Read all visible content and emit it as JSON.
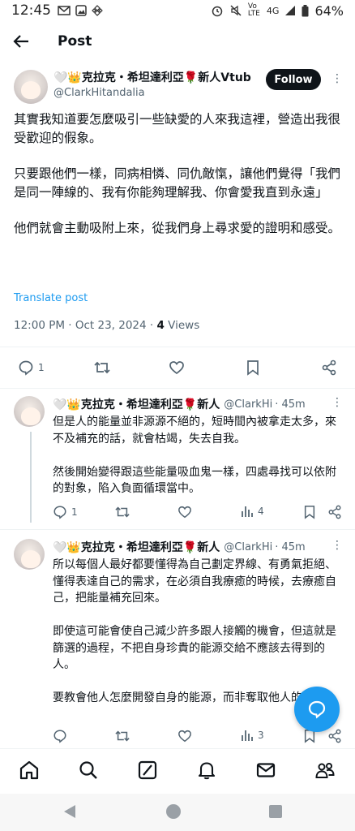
{
  "status_bar": {
    "time": "12:45",
    "network": "4G",
    "battery": "64%",
    "volte": "Vo LTE"
  },
  "header": {
    "title": "Post"
  },
  "main_post": {
    "author_name": "🤍👑克拉克・希坦達利亞🌹新人Vtub",
    "handle": "@ClarkHitandalia",
    "follow_label": "Follow",
    "paragraphs": [
      "其實我知道要怎麼吸引一些缺愛的人來我這裡，營造出我很受歡迎的假象。",
      "只要跟他們一樣，同病相憐、同仇敵愾，讓他們覺得「我們是同一陣線的、我有你能夠理解我、你會愛我直到永遠」",
      "他們就會主動吸附上來，從我們身上尋求愛的證明和感受。"
    ],
    "translate_label": "Translate post",
    "timestamp": "12:00 PM · Oct 23, 2024 · ",
    "views_count": "4",
    "views_label": " Views",
    "reply_count": "1"
  },
  "replies": [
    {
      "author_name": "🤍👑克拉克・希坦達利亞🌹新人",
      "handle": "@ClarkHi",
      "time": "· 45m",
      "paragraphs": [
        "但是人的能量並非源源不絕的，短時間內被拿走太多，來不及補充的話，就會枯竭，失去自我。",
        "然後開始變得跟這些能量吸血鬼一樣，四處尋找可以依附的對象，陷入負面循環當中。"
      ],
      "reply_count": "1",
      "views_count": "4"
    },
    {
      "author_name": "🤍👑克拉克・希坦達利亞🌹新人",
      "handle": "@ClarkHi",
      "time": "· 45m",
      "paragraphs": [
        "所以每個人最好都要懂得為自己劃定界線、有勇氣拒絕、懂得表達自己的需求，在必須自我療癒的時候，去療癒自己，把能量補充回來。",
        "即使這可能會使自己減少許多跟人接觸的機會，但這就是篩選的過程，不把自身珍貴的能源交給不應該去得到的人。",
        "要教會他人怎麼開發自身的能源，而非奪取他人的能源。"
      ],
      "reply_count": "",
      "views_count": "3"
    }
  ],
  "icons": {
    "back": "arrow-left-icon",
    "reply": "comment-icon",
    "repost": "repost-icon",
    "like": "heart-icon",
    "bookmark": "bookmark-icon",
    "share": "share-icon",
    "views": "bar-chart-icon",
    "fab": "compose-chat-icon"
  },
  "colors": {
    "accent": "#1d9bf0",
    "text": "#0f1419",
    "secondary": "#536471"
  }
}
